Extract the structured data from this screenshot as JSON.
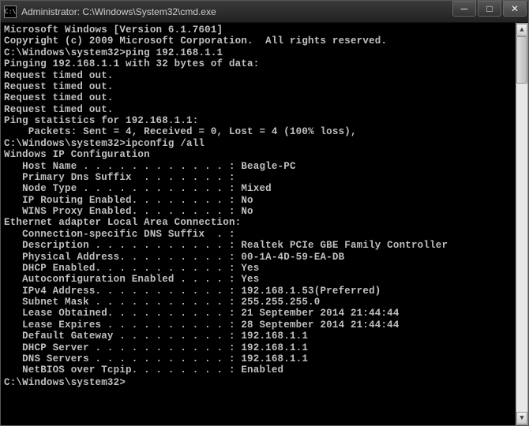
{
  "titlebar": {
    "icon_text": "C:\\",
    "title": "Administrator: C:\\Windows\\System32\\cmd.exe"
  },
  "lines": {
    "l1": "Microsoft Windows [Version 6.1.7601]",
    "l2": "Copyright (c) 2009 Microsoft Corporation.  All rights reserved.",
    "l3": "",
    "l4": "C:\\Windows\\system32>ping 192.168.1.1",
    "l5": "",
    "l6": "Pinging 192.168.1.1 with 32 bytes of data:",
    "l7": "Request timed out.",
    "l8": "Request timed out.",
    "l9": "Request timed out.",
    "l10": "Request timed out.",
    "l11": "",
    "l12": "Ping statistics for 192.168.1.1:",
    "l13": "    Packets: Sent = 4, Received = 0, Lost = 4 (100% loss),",
    "l14": "",
    "l15": "C:\\Windows\\system32>ipconfig /all",
    "l16": "",
    "l17": "Windows IP Configuration",
    "l18": "",
    "l19": "   Host Name . . . . . . . . . . . . : Beagle-PC",
    "l20": "   Primary Dns Suffix  . . . . . . . :",
    "l21": "   Node Type . . . . . . . . . . . . : Mixed",
    "l22": "   IP Routing Enabled. . . . . . . . : No",
    "l23": "   WINS Proxy Enabled. . . . . . . . : No",
    "l24": "",
    "l25": "Ethernet adapter Local Area Connection:",
    "l26": "",
    "l27": "   Connection-specific DNS Suffix  . :",
    "l28": "   Description . . . . . . . . . . . : Realtek PCIe GBE Family Controller",
    "l29": "   Physical Address. . . . . . . . . : 00-1A-4D-59-EA-DB",
    "l30": "   DHCP Enabled. . . . . . . . . . . : Yes",
    "l31": "   Autoconfiguration Enabled . . . . : Yes",
    "l32": "   IPv4 Address. . . . . . . . . . . : 192.168.1.53(Preferred)",
    "l33": "   Subnet Mask . . . . . . . . . . . : 255.255.255.0",
    "l34": "   Lease Obtained. . . . . . . . . . : 21 September 2014 21:44:44",
    "l35": "   Lease Expires . . . . . . . . . . : 28 September 2014 21:44:44",
    "l36": "   Default Gateway . . . . . . . . . : 192.168.1.1",
    "l37": "   DHCP Server . . . . . . . . . . . : 192.168.1.1",
    "l38": "   DNS Servers . . . . . . . . . . . : 192.168.1.1",
    "l39": "   NetBIOS over Tcpip. . . . . . . . : Enabled",
    "l40": "",
    "l41": "C:\\Windows\\system32>"
  }
}
